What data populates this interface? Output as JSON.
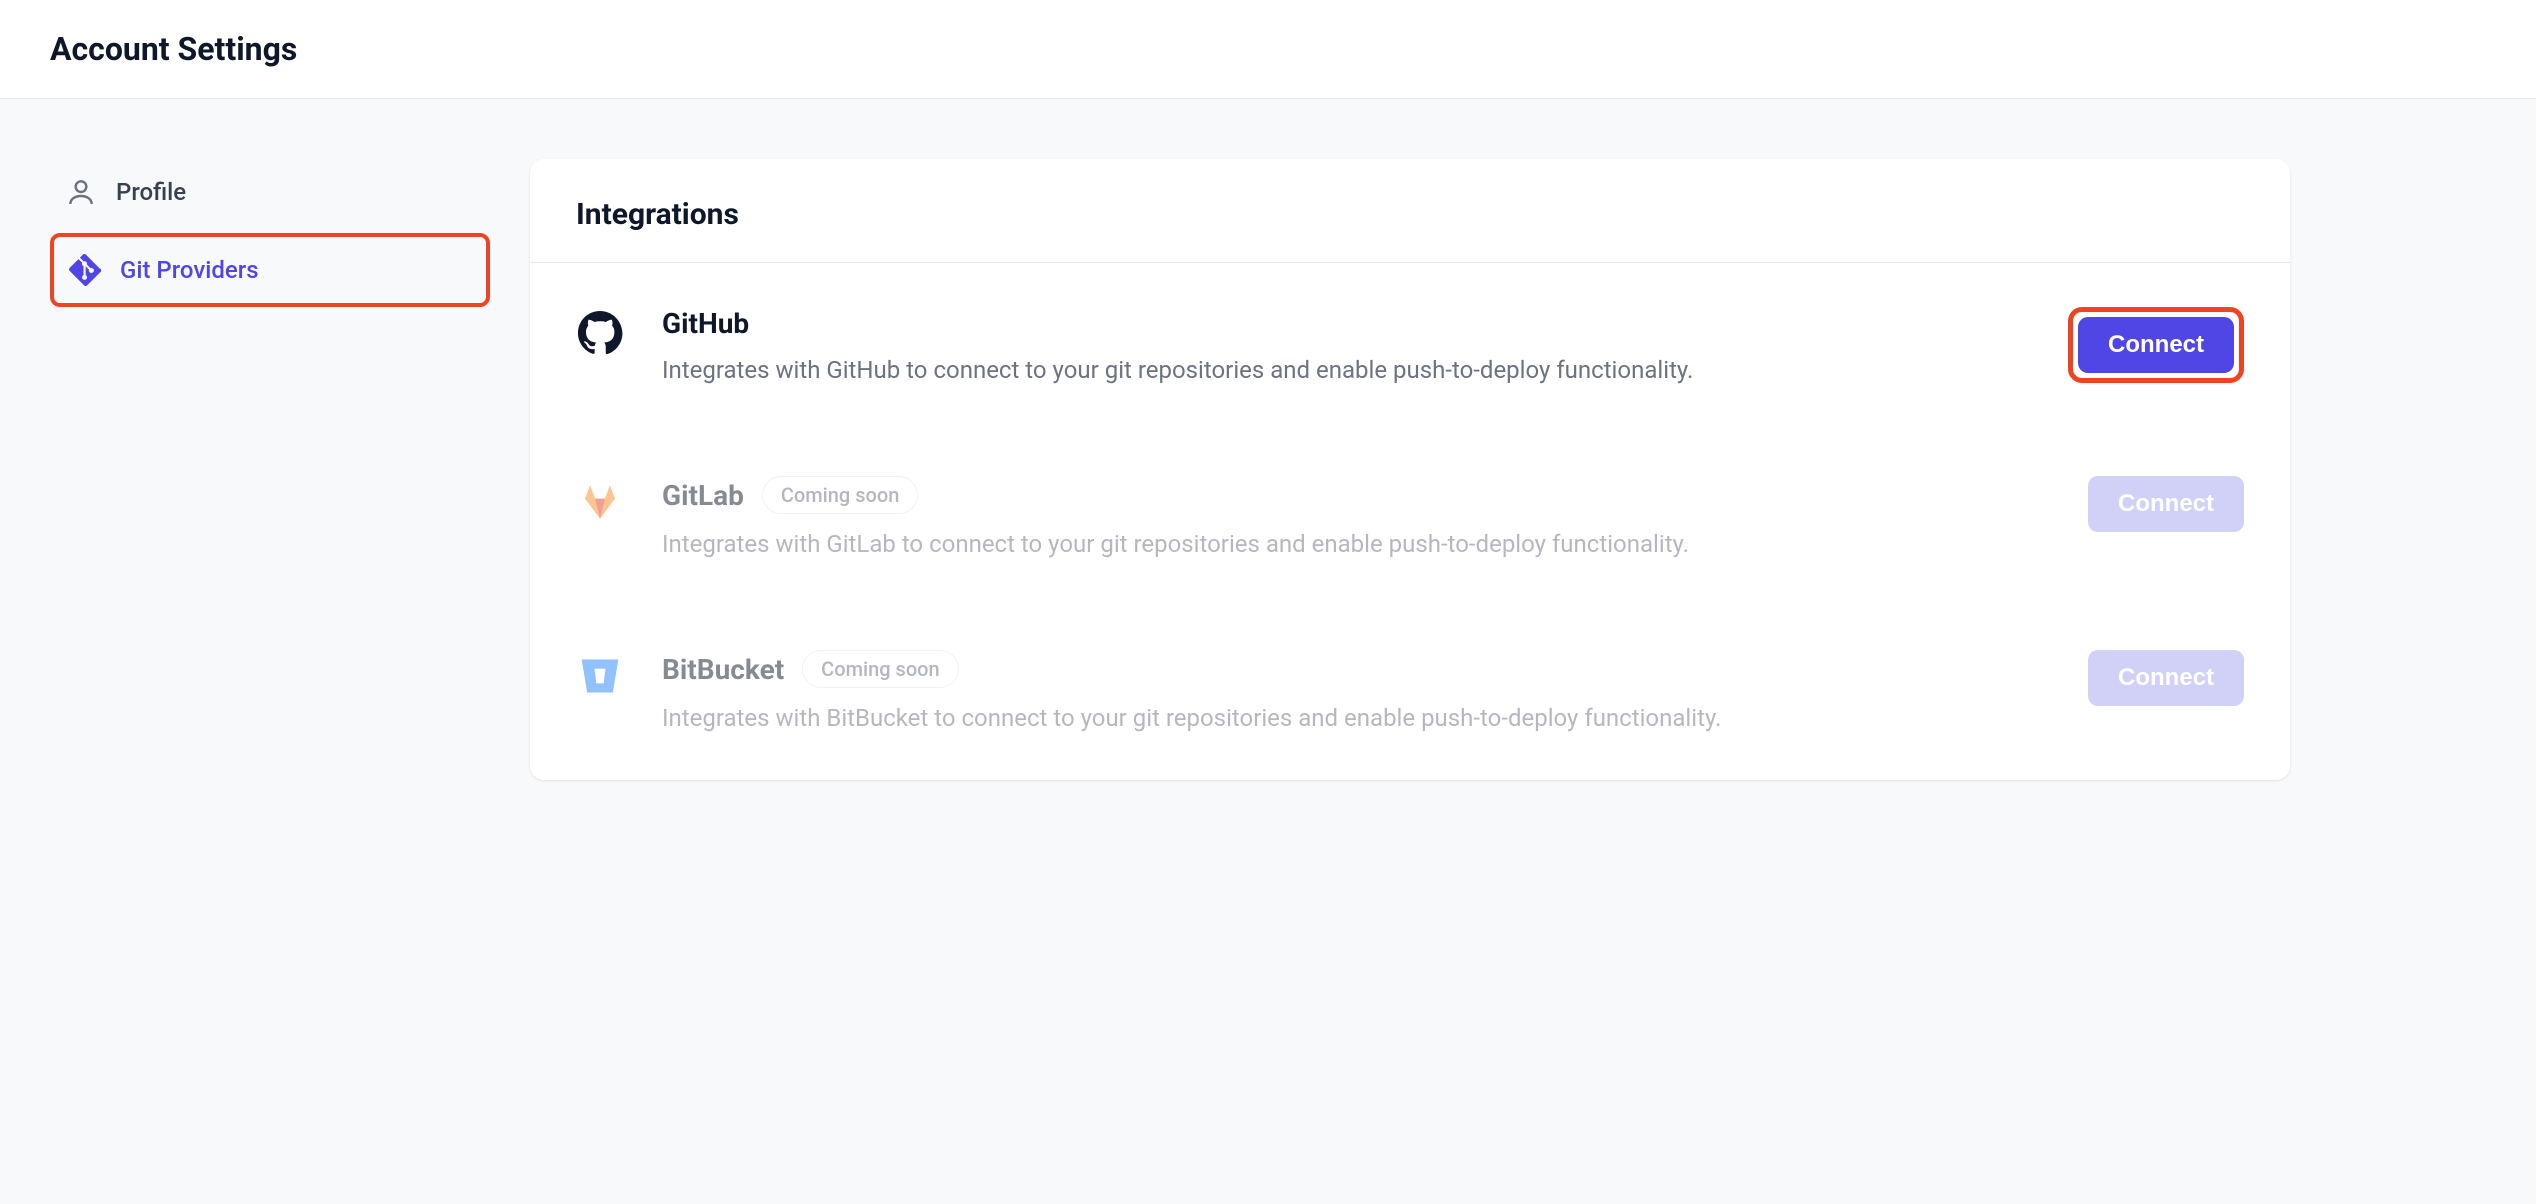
{
  "header": {
    "title": "Account Settings"
  },
  "sidebar": {
    "items": [
      {
        "label": "Profile"
      },
      {
        "label": "Git Providers"
      }
    ]
  },
  "panel": {
    "title": "Integrations",
    "integrations": [
      {
        "name": "GitHub",
        "desc": "Integrates with GitHub to connect to your git repositories and enable push-to-deploy functionality.",
        "button": "Connect"
      },
      {
        "name": "GitLab",
        "badge": "Coming soon",
        "desc": "Integrates with GitLab to connect to your git repositories and enable push-to-deploy functionality.",
        "button": "Connect"
      },
      {
        "name": "BitBucket",
        "badge": "Coming soon",
        "desc": "Integrates with BitBucket to connect to your git repositories and enable push-to-deploy functionality.",
        "button": "Connect"
      }
    ]
  }
}
